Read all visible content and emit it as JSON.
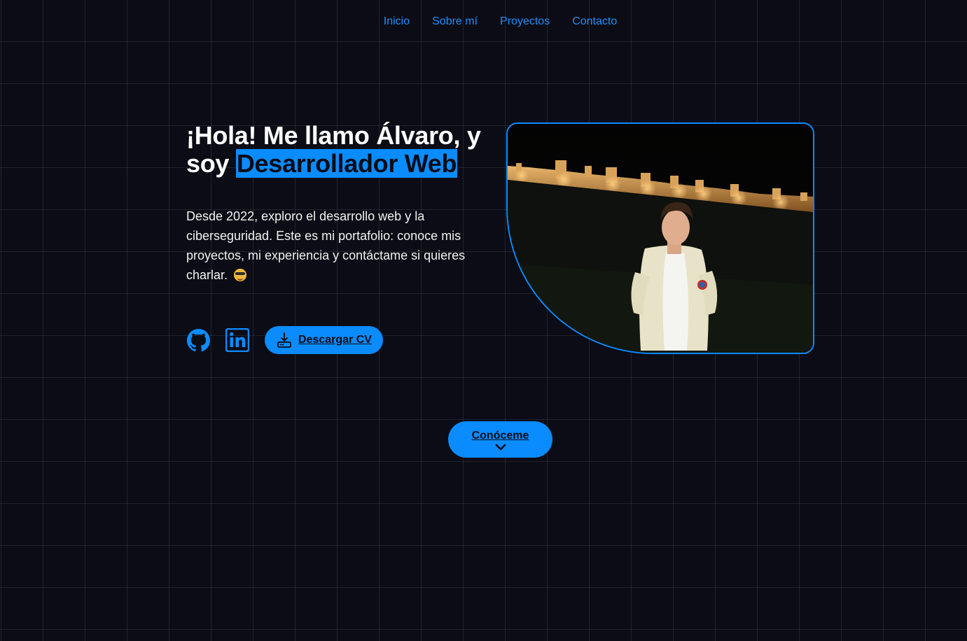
{
  "nav": {
    "items": [
      {
        "label": "Inicio"
      },
      {
        "label": "Sobre mí"
      },
      {
        "label": "Proyectos"
      },
      {
        "label": "Contacto"
      }
    ]
  },
  "hero": {
    "title_prefix": "¡Hola! Me llamo Álvaro, y soy ",
    "title_highlight": "Desarrollador Web",
    "description": "Desde 2022, exploro el desarrollo web y la ciberseguridad. Este es mi portafolio: conoce mis proyectos, mi experiencia y contáctame si quieres charlar.",
    "emoji": "smiling-face-with-sunglasses",
    "cv_button_label": "Descargar CV",
    "know_me_label": "Conóceme"
  },
  "icons": {
    "github": "github-icon",
    "linkedin": "linkedin-icon",
    "download": "download-icon",
    "chevron": "chevron-down-icon"
  },
  "colors": {
    "accent": "#0a8cff",
    "background": "#0c0c16",
    "nav_link": "#1f8fff",
    "text": "#ffffff"
  }
}
